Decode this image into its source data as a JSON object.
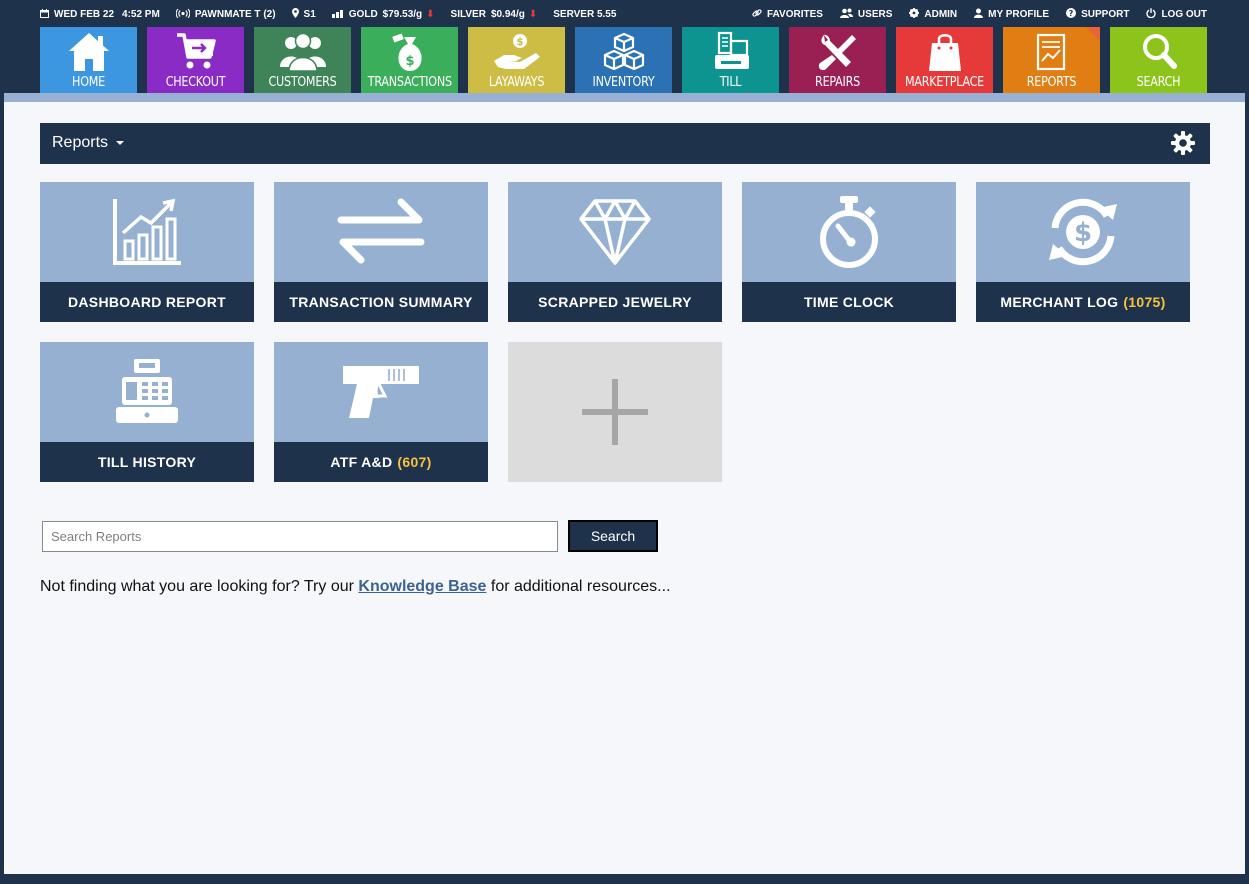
{
  "status": {
    "date": "WED FEB 22",
    "time": "4:52 PM",
    "device": "PAWNMATE T (2)",
    "store": "S1",
    "gold_label": "GOLD",
    "gold_price": "$79.53/g",
    "silver_label": "SILVER",
    "silver_price": "$0.94/g",
    "server": "SERVER 5.55",
    "price_down_color": "#e53935"
  },
  "top_links": {
    "favorites": "FAVORITES",
    "users": "USERS",
    "admin": "ADMIN",
    "my_profile": "MY PROFILE",
    "support": "SUPPORT",
    "log_out": "LOG OUT"
  },
  "nav": [
    {
      "label": "HOME",
      "color": "#3d96e0",
      "icon": "house-icon"
    },
    {
      "label": "CHECKOUT",
      "color": "#8b2bc5",
      "icon": "cart-icon"
    },
    {
      "label": "CUSTOMERS",
      "color": "#3e8458",
      "icon": "people-icon"
    },
    {
      "label": "TRANSACTIONS",
      "color": "#3aae5a",
      "icon": "money-bag-icon"
    },
    {
      "label": "LAYAWAYS",
      "color": "#cdbd44",
      "icon": "hand-coin-icon"
    },
    {
      "label": "INVENTORY",
      "color": "#2a72b3",
      "icon": "boxes-icon"
    },
    {
      "label": "TILL",
      "color": "#0e9490",
      "icon": "register-icon"
    },
    {
      "label": "REPAIRS",
      "color": "#9a1f52",
      "icon": "tools-icon"
    },
    {
      "label": "MARKETPLACE",
      "color": "#e63a3a",
      "icon": "shopping-bag-icon"
    },
    {
      "label": "REPORTS",
      "color": "#e07e14",
      "icon": "report-icon"
    },
    {
      "label": "SEARCH",
      "color": "#8cc41b",
      "icon": "magnifier-icon"
    }
  ],
  "page": {
    "title": "Reports"
  },
  "reports": [
    {
      "label": "DASHBOARD REPORT",
      "count": "",
      "icon": "bar-chart-icon"
    },
    {
      "label": "TRANSACTION SUMMARY",
      "count": "",
      "icon": "swap-arrows-icon"
    },
    {
      "label": "SCRAPPED JEWELRY",
      "count": "",
      "icon": "diamond-icon"
    },
    {
      "label": "TIME CLOCK",
      "count": "",
      "icon": "stopwatch-icon"
    },
    {
      "label": "MERCHANT LOG",
      "count": "(1075)",
      "icon": "dollar-refresh-icon"
    },
    {
      "label": "TILL HISTORY",
      "count": "",
      "icon": "cash-register-icon"
    },
    {
      "label": "ATF A&D",
      "count": "(607)",
      "icon": "pistol-icon"
    }
  ],
  "search": {
    "placeholder": "Search Reports",
    "button_label": "Search"
  },
  "help": {
    "prefix": "Not finding what you are looking for? Try our ",
    "link_text": "Knowledge Base",
    "suffix": " for additional resources..."
  }
}
